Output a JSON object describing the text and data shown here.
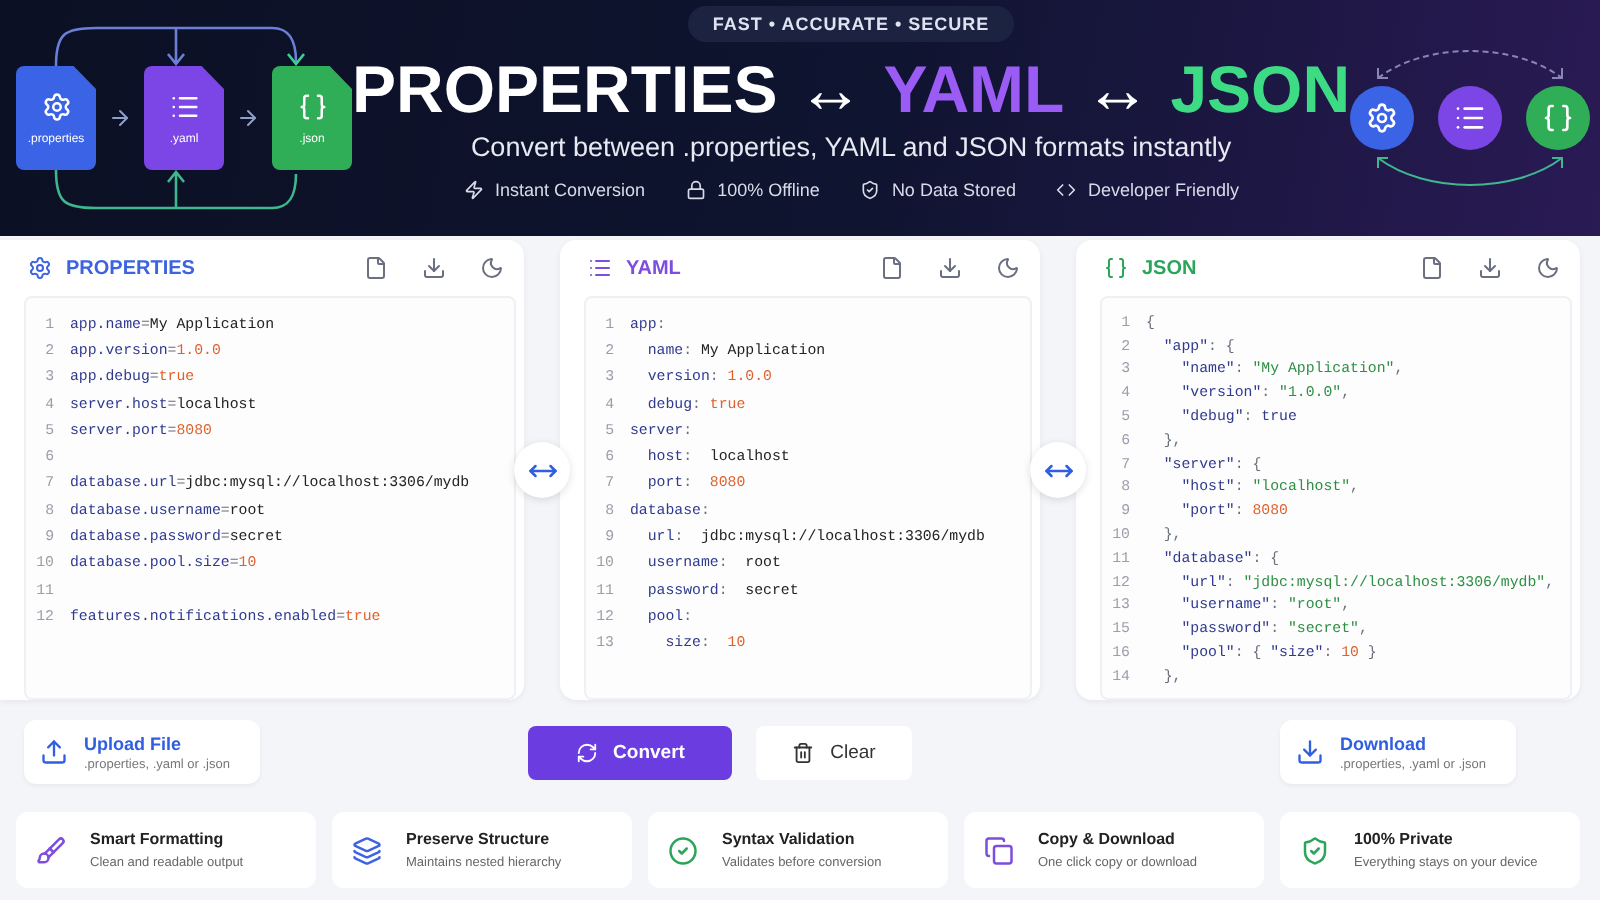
{
  "banner": {
    "file_labels": [
      {
        "kind": "properties",
        "label": ".properties"
      },
      {
        "kind": "yaml",
        "label": ".yaml"
      },
      {
        "kind": "json",
        "label": ".json"
      }
    ],
    "tagline": "FAST • ACCURATE • SECURE",
    "title": [
      {
        "text": "PROPERTIES",
        "color": "#ffffff"
      },
      {
        "text": "↔",
        "color": "#ffffff"
      },
      {
        "text": "YAML",
        "color": "#9b5cf6"
      },
      {
        "text": "↔",
        "color": "#ffffff"
      },
      {
        "text": "JSON",
        "color": "#3ddc84"
      }
    ],
    "subtitle": "Convert between .properties, YAML and JSON formats instantly",
    "highlights": [
      {
        "kind": "bolt",
        "label": "Instant Conversion"
      },
      {
        "kind": "lock",
        "label": "100% Offline"
      },
      {
        "kind": "shield",
        "label": "No Data Stored"
      },
      {
        "kind": "code",
        "label": "Developer Friendly"
      }
    ]
  },
  "editors": [
    {
      "kind": "properties",
      "title": "PROPERTIES",
      "lines": [
        {
          "number": "1",
          "tokens": [
            {
              "text": "app.name",
              "kind": "key"
            },
            {
              "text": "=",
              "kind": "op"
            },
            {
              "text": "My Application",
              "kind": "text"
            }
          ]
        },
        {
          "number": "2",
          "tokens": [
            {
              "text": "app.version",
              "kind": "key"
            },
            {
              "text": "=",
              "kind": "op"
            },
            {
              "text": "1.0.0",
              "kind": "num"
            }
          ]
        },
        {
          "number": "3",
          "tokens": [
            {
              "text": "app.debug",
              "kind": "key"
            },
            {
              "text": "=",
              "kind": "op"
            },
            {
              "text": "true",
              "kind": "num"
            }
          ]
        },
        {
          "number": "4",
          "tokens": [
            {
              "text": "server.host",
              "kind": "key"
            },
            {
              "text": "=",
              "kind": "op"
            },
            {
              "text": "localhost",
              "kind": "text"
            }
          ]
        },
        {
          "number": "5",
          "tokens": [
            {
              "text": "server.port",
              "kind": "key"
            },
            {
              "text": "=",
              "kind": "op"
            },
            {
              "text": "8080",
              "kind": "num"
            }
          ]
        },
        {
          "number": "6"
        },
        {
          "number": "7",
          "tokens": [
            {
              "text": "database.url",
              "kind": "key"
            },
            {
              "text": "=",
              "kind": "op"
            },
            {
              "text": "jdbc:mysql://localhost:3306/mydb",
              "kind": "text"
            }
          ]
        },
        {
          "number": "8",
          "tokens": [
            {
              "text": "database.username",
              "kind": "key"
            },
            {
              "text": "=",
              "kind": "op"
            },
            {
              "text": "root",
              "kind": "text"
            }
          ]
        },
        {
          "number": "9",
          "tokens": [
            {
              "text": "database.password",
              "kind": "key"
            },
            {
              "text": "=",
              "kind": "op"
            },
            {
              "text": "secret",
              "kind": "text"
            }
          ]
        },
        {
          "number": "10",
          "tokens": [
            {
              "text": "database.pool.size",
              "kind": "key"
            },
            {
              "text": "=",
              "kind": "op"
            },
            {
              "text": "10",
              "kind": "num"
            }
          ]
        },
        {
          "number": "11"
        },
        {
          "number": "12",
          "tokens": [
            {
              "text": "features.notifications.enabled",
              "kind": "key"
            },
            {
              "text": "=",
              "kind": "op"
            },
            {
              "text": "true",
              "kind": "num"
            }
          ]
        }
      ]
    },
    {
      "kind": "yaml",
      "title": "YAML",
      "lines": [
        {
          "number": "1",
          "tokens": [
            {
              "text": "app",
              "kind": "key"
            },
            {
              "text": ":",
              "kind": "op"
            }
          ]
        },
        {
          "number": "2",
          "tokens": [
            {
              "text": "  name",
              "kind": "key"
            },
            {
              "text": ":",
              "kind": "op"
            },
            {
              "text": " My Application",
              "kind": "text"
            }
          ]
        },
        {
          "number": "3",
          "tokens": [
            {
              "text": "  version",
              "kind": "key"
            },
            {
              "text": ":",
              "kind": "op"
            },
            {
              "text": " 1.0.0",
              "kind": "num"
            }
          ]
        },
        {
          "number": "4",
          "tokens": [
            {
              "text": "  debug",
              "kind": "key"
            },
            {
              "text": ":",
              "kind": "op"
            },
            {
              "text": " true",
              "kind": "num"
            }
          ]
        },
        {
          "number": "5",
          "tokens": [
            {
              "text": "server",
              "kind": "key"
            },
            {
              "text": ":",
              "kind": "op"
            }
          ]
        },
        {
          "number": "6",
          "tokens": [
            {
              "text": "  host",
              "kind": "key"
            },
            {
              "text": ":",
              "kind": "op"
            },
            {
              "text": "  localhost",
              "kind": "text"
            }
          ]
        },
        {
          "number": "7",
          "tokens": [
            {
              "text": "  port",
              "kind": "key"
            },
            {
              "text": ":",
              "kind": "op"
            },
            {
              "text": "  8080",
              "kind": "num"
            }
          ]
        },
        {
          "number": "8",
          "tokens": [
            {
              "text": "database",
              "kind": "key"
            },
            {
              "text": ":",
              "kind": "op"
            }
          ]
        },
        {
          "number": "9",
          "tokens": [
            {
              "text": "  url",
              "kind": "key"
            },
            {
              "text": ":",
              "kind": "op"
            },
            {
              "text": "  jdbc:mysql://localhost:3306/mydb",
              "kind": "text"
            }
          ]
        },
        {
          "number": "10",
          "tokens": [
            {
              "text": "  username",
              "kind": "key"
            },
            {
              "text": ":",
              "kind": "op"
            },
            {
              "text": "  root",
              "kind": "text"
            }
          ]
        },
        {
          "number": "11",
          "tokens": [
            {
              "text": "  password",
              "kind": "key"
            },
            {
              "text": ":",
              "kind": "op"
            },
            {
              "text": "  secret",
              "kind": "text"
            }
          ]
        },
        {
          "number": "12",
          "tokens": [
            {
              "text": "  pool",
              "kind": "key"
            },
            {
              "text": ":",
              "kind": "op"
            }
          ]
        },
        {
          "number": "13",
          "tokens": [
            {
              "text": "    size",
              "kind": "key"
            },
            {
              "text": ":",
              "kind": "op"
            },
            {
              "text": "  10",
              "kind": "num"
            }
          ]
        }
      ]
    },
    {
      "kind": "json",
      "title": "JSON",
      "lines": [
        {
          "number": "1",
          "tokens": [
            {
              "text": "{",
              "kind": "op"
            }
          ]
        },
        {
          "number": "2",
          "tokens": [
            {
              "text": "  \"app\"",
              "kind": "key"
            },
            {
              "text": ": {",
              "kind": "op"
            }
          ]
        },
        {
          "number": "3",
          "tokens": [
            {
              "text": "    \"name\"",
              "kind": "key"
            },
            {
              "text": ": ",
              "kind": "op"
            },
            {
              "text": "\"My Application\"",
              "kind": "str"
            },
            {
              "text": ",",
              "kind": "op"
            }
          ]
        },
        {
          "number": "4",
          "tokens": [
            {
              "text": "    \"version\"",
              "kind": "key"
            },
            {
              "text": ": ",
              "kind": "op"
            },
            {
              "text": "\"1.0.0\"",
              "kind": "str"
            },
            {
              "text": ",",
              "kind": "op"
            }
          ]
        },
        {
          "number": "5",
          "tokens": [
            {
              "text": "    \"debug\"",
              "kind": "key"
            },
            {
              "text": ": ",
              "kind": "op"
            },
            {
              "text": "true",
              "kind": "key"
            }
          ]
        },
        {
          "number": "6",
          "tokens": [
            {
              "text": "  },",
              "kind": "op"
            }
          ]
        },
        {
          "number": "7",
          "tokens": [
            {
              "text": "  \"server\"",
              "kind": "key"
            },
            {
              "text": ": {",
              "kind": "op"
            }
          ]
        },
        {
          "number": "8",
          "tokens": [
            {
              "text": "    \"host\"",
              "kind": "key"
            },
            {
              "text": ": ",
              "kind": "op"
            },
            {
              "text": "\"localhost\"",
              "kind": "str"
            },
            {
              "text": ",",
              "kind": "op"
            }
          ]
        },
        {
          "number": "9",
          "tokens": [
            {
              "text": "    \"port\"",
              "kind": "key"
            },
            {
              "text": ": ",
              "kind": "op"
            },
            {
              "text": "8080",
              "kind": "num"
            }
          ]
        },
        {
          "number": "10",
          "tokens": [
            {
              "text": "  },",
              "kind": "op"
            }
          ]
        },
        {
          "number": "11",
          "tokens": [
            {
              "text": "  \"database\"",
              "kind": "key"
            },
            {
              "text": ": {",
              "kind": "op"
            }
          ]
        },
        {
          "number": "12",
          "tokens": [
            {
              "text": "    \"url\"",
              "kind": "key"
            },
            {
              "text": ": ",
              "kind": "op"
            },
            {
              "text": "\"jdbc:mysql://localhost:3306/mydb\"",
              "kind": "str"
            },
            {
              "text": ",",
              "kind": "op"
            }
          ]
        },
        {
          "number": "13",
          "tokens": [
            {
              "text": "    \"username\"",
              "kind": "key"
            },
            {
              "text": ": ",
              "kind": "op"
            },
            {
              "text": "\"root\"",
              "kind": "str"
            },
            {
              "text": ",",
              "kind": "op"
            }
          ]
        },
        {
          "number": "15",
          "tokens": [
            {
              "text": "    \"password\"",
              "kind": "key"
            },
            {
              "text": ": ",
              "kind": "op"
            },
            {
              "text": "\"secret\"",
              "kind": "str"
            },
            {
              "text": ",",
              "kind": "op"
            }
          ]
        },
        {
          "number": "16",
          "tokens": [
            {
              "text": "    \"pool\"",
              "kind": "key"
            },
            {
              "text": ": { ",
              "kind": "op"
            },
            {
              "text": "\"size\"",
              "kind": "key"
            },
            {
              "text": ": ",
              "kind": "op"
            },
            {
              "text": "10",
              "kind": "num"
            },
            {
              "text": " }",
              "kind": "op"
            }
          ]
        },
        {
          "number": "14",
          "tokens": [
            {
              "text": "  },",
              "kind": "op"
            }
          ]
        }
      ]
    }
  ],
  "actions": {
    "upload": {
      "title": "Upload File",
      "hint": ".properties, .yaml or .json"
    },
    "convert": "Convert",
    "clear": "Clear",
    "download": {
      "title": "Download",
      "hint": ".properties, .yaml or .json"
    }
  },
  "features": [
    {
      "kind": "brush",
      "title": "Smart Formatting",
      "text": "Clean and readable output"
    },
    {
      "kind": "layers",
      "title": "Preserve Structure",
      "text": "Maintains nested hierarchy"
    },
    {
      "kind": "check",
      "title": "Syntax Validation",
      "text": "Validates before conversion"
    },
    {
      "kind": "copy",
      "title": "Copy & Download",
      "text": "One click copy or download"
    },
    {
      "kind": "shield",
      "title": "100% Private",
      "text": "Everything stays on your device"
    }
  ]
}
